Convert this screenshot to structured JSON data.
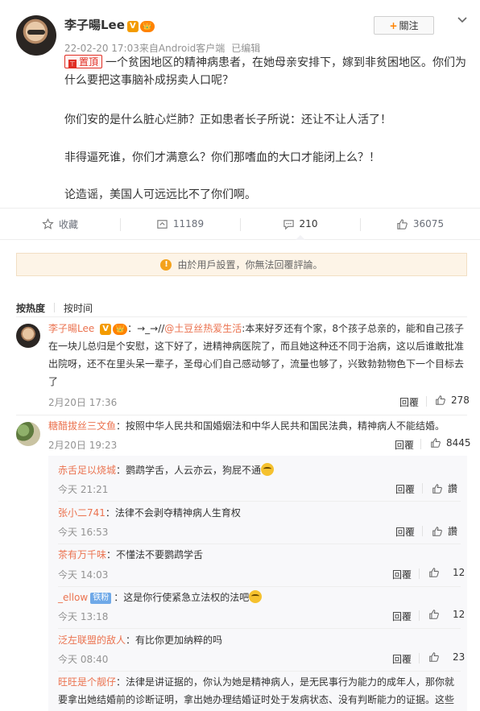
{
  "post": {
    "author": "李子暘Lee",
    "v_badge": "V",
    "vip_badge": "👑",
    "time": "22-02-20 17:03",
    "source": "来自Android客户端",
    "edited": "已编辑",
    "follow_label": "關注",
    "follow_plus": "+",
    "pin_label": "置頂",
    "pin_icon": "⊤",
    "paragraphs": [
      "一个贫困地区的精神病患者，在她母亲安排下，嫁到非贫困地区。你们为什么要把这事脑补成拐卖人口呢？",
      "你们安的是什么脏心烂肺？正如患者长子所说：还让不让人活了！",
      "非得逼死谁，你们才满意么？你们那嗜血的大口才能闭上么？！",
      "论造谣，美国人可远远比不了你们啊。"
    ]
  },
  "actions": {
    "favorite": "收藏",
    "repost_count": "11189",
    "comment_count": "210",
    "like_count": "36075"
  },
  "notice": {
    "icon": "!",
    "text": "由於用戶設置，你無法回覆評論。"
  },
  "sort": {
    "hot": "按热度",
    "time": "按时间"
  },
  "comments": [
    {
      "nick": "李子暘Lee",
      "badges": "V 👑",
      "prefix": "：→_→//",
      "at": "@土豆丝热爱生活",
      "text": ":本来好歹还有个家，8个孩子总亲的，能和自己孩子在一块儿总归是个安慰，这下好了，进精神病医院了，而且她这种还不同于治病，这以后谁敢批准出院呀，还不在里头呆一辈子，圣母心们自己感动够了，流量也够了，兴致勃勃物色下一个目标去了",
      "time": "2月20日 17:36",
      "reply": "回覆",
      "likes": "278"
    },
    {
      "nick": "糖醋拔丝三文鱼",
      "text": "：按照中华人民共和国婚姻法和中华人民共和国民法典，精神病人不能结婚。",
      "time": "2月20日 19:23",
      "reply": "回覆",
      "likes": "8445"
    }
  ],
  "replies": [
    {
      "nick": "赤舌足以烧城",
      "text": "：鹦鹉学舌，人云亦云，狗屁不通",
      "time": "今天 21:21",
      "reply": "回覆",
      "likes": "讚"
    },
    {
      "nick": "张小二741",
      "text": "：法律不会剥夺精神病人生育权",
      "time": "今天 16:53",
      "reply": "回覆",
      "likes": "讚"
    },
    {
      "nick": "茶有万千味",
      "text": "：不懂法不要鹦鹉学舌",
      "time": "今天 14:03",
      "reply": "回覆",
      "likes": "12"
    },
    {
      "nick": "_ellow",
      "tag": "铁粉",
      "text": "：这是你行使紧急立法权的法吧",
      "time": "今天 13:18",
      "reply": "回覆",
      "likes": "12"
    },
    {
      "nick": "泛左联盟的敌人",
      "text": "：有比你更加纳粹的吗",
      "time": "今天 08:40",
      "reply": "回覆",
      "likes": "23"
    },
    {
      "nick": "旺旺是个靓仔",
      "text": "：法律是讲证据的，你认为她是精神病人，是无民事行为能力的成年人，那你就要拿出她结婚前的诊断证明，拿出她办理结婚证时处于发病状态、没有判断能力的证据。这些"
    }
  ]
}
